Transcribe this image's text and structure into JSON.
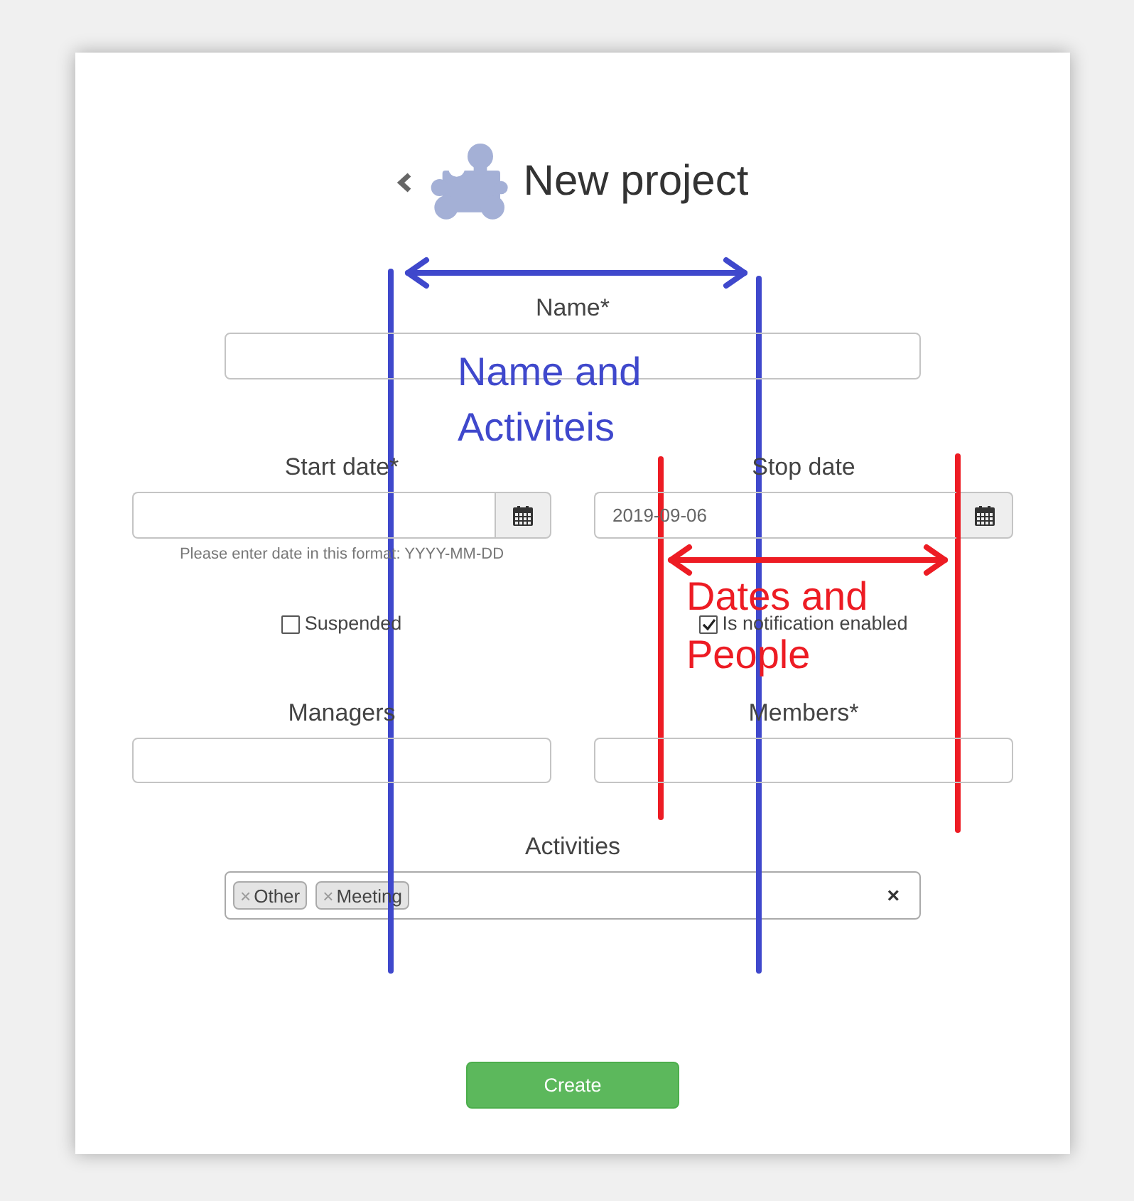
{
  "header": {
    "title": "New project"
  },
  "form": {
    "name": {
      "label": "Name*"
    },
    "date_fields": [
      {
        "label": "Start date*",
        "hint": "Please enter date in this format: YYYY-MM-DD"
      },
      {
        "label": "Stop date",
        "value": "2019-09-06"
      }
    ],
    "checkboxes": [
      {
        "label": "Suspended",
        "checked": false
      },
      {
        "label": "Is notification enabled",
        "checked": true
      }
    ],
    "people_fields": [
      {
        "label": "Managers"
      },
      {
        "label": "Members*"
      }
    ],
    "activities": {
      "label": "Activities",
      "tags": [
        {
          "remove": "×",
          "label": "Other"
        },
        {
          "remove": "×",
          "label": "Meeting"
        }
      ],
      "clear": "×"
    }
  },
  "actions": {
    "create": "Create"
  },
  "annotations": [
    {
      "lines": [
        "Name and",
        "Activiteis"
      ],
      "color": "#3f48cc"
    },
    {
      "lines": [
        "Dates and",
        "People"
      ],
      "color": "#ed1c24"
    }
  ]
}
